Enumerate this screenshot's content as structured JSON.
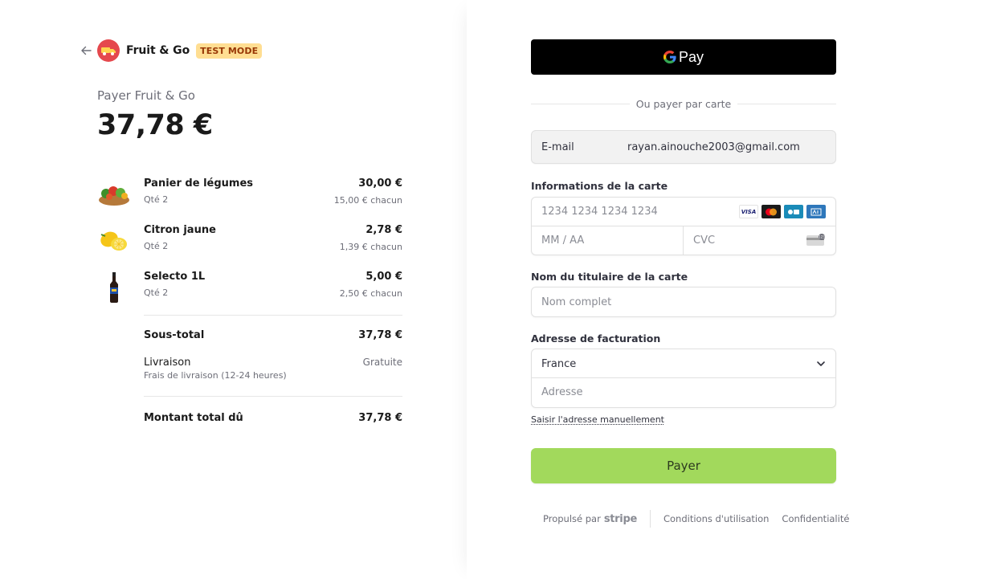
{
  "merchant": {
    "name": "Fruit & Go",
    "mode_badge": "TEST MODE"
  },
  "summary": {
    "pay_label": "Payer Fruit & Go",
    "amount": "37,78 €"
  },
  "items": [
    {
      "name": "Panier de légumes",
      "qty": "Qté 2",
      "price": "30,00 €",
      "unit": "15,00 € chacun",
      "icon": "vegetable-basket-icon"
    },
    {
      "name": "Citron jaune",
      "qty": "Qté 2",
      "price": "2,78 €",
      "unit": "1,39 € chacun",
      "icon": "lemon-icon"
    },
    {
      "name": "Selecto 1L",
      "qty": "Qté 2",
      "price": "5,00 €",
      "unit": "2,50 € chacun",
      "icon": "soda-bottle-icon"
    }
  ],
  "totals": {
    "subtotal_label": "Sous-total",
    "subtotal_value": "37,78 €",
    "shipping_label": "Livraison",
    "shipping_desc": "Frais de livraison (12-24 heures)",
    "shipping_value": "Gratuite",
    "total_label": "Montant total dû",
    "total_value": "37,78 €"
  },
  "form": {
    "gpay_label": "Pay",
    "or_text": "Ou payer par carte",
    "email_label": "E-mail",
    "email_value": "rayan.ainouche2003@gmail.com",
    "card_label": "Informations de la carte",
    "card_number_placeholder": "1234 1234 1234 1234",
    "expiry_placeholder": "MM / AA",
    "cvc_placeholder": "CVC",
    "card_brands": [
      "VISA",
      "Mastercard",
      "CB",
      "AMEX"
    ],
    "holder_label": "Nom du titulaire de la carte",
    "holder_placeholder": "Nom complet",
    "address_label": "Adresse de facturation",
    "country_value": "France",
    "address_placeholder": "Adresse",
    "manual_link": "Saisir l'adresse manuellement",
    "pay_button": "Payer"
  },
  "footer": {
    "powered_by": "Propulsé par",
    "stripe": "stripe",
    "terms": "Conditions d'utilisation",
    "privacy": "Confidentialité"
  },
  "colors": {
    "accent_pay_button": "#a2d95c",
    "badge_bg": "#ffde92",
    "logo_bg": "#e5484d"
  }
}
